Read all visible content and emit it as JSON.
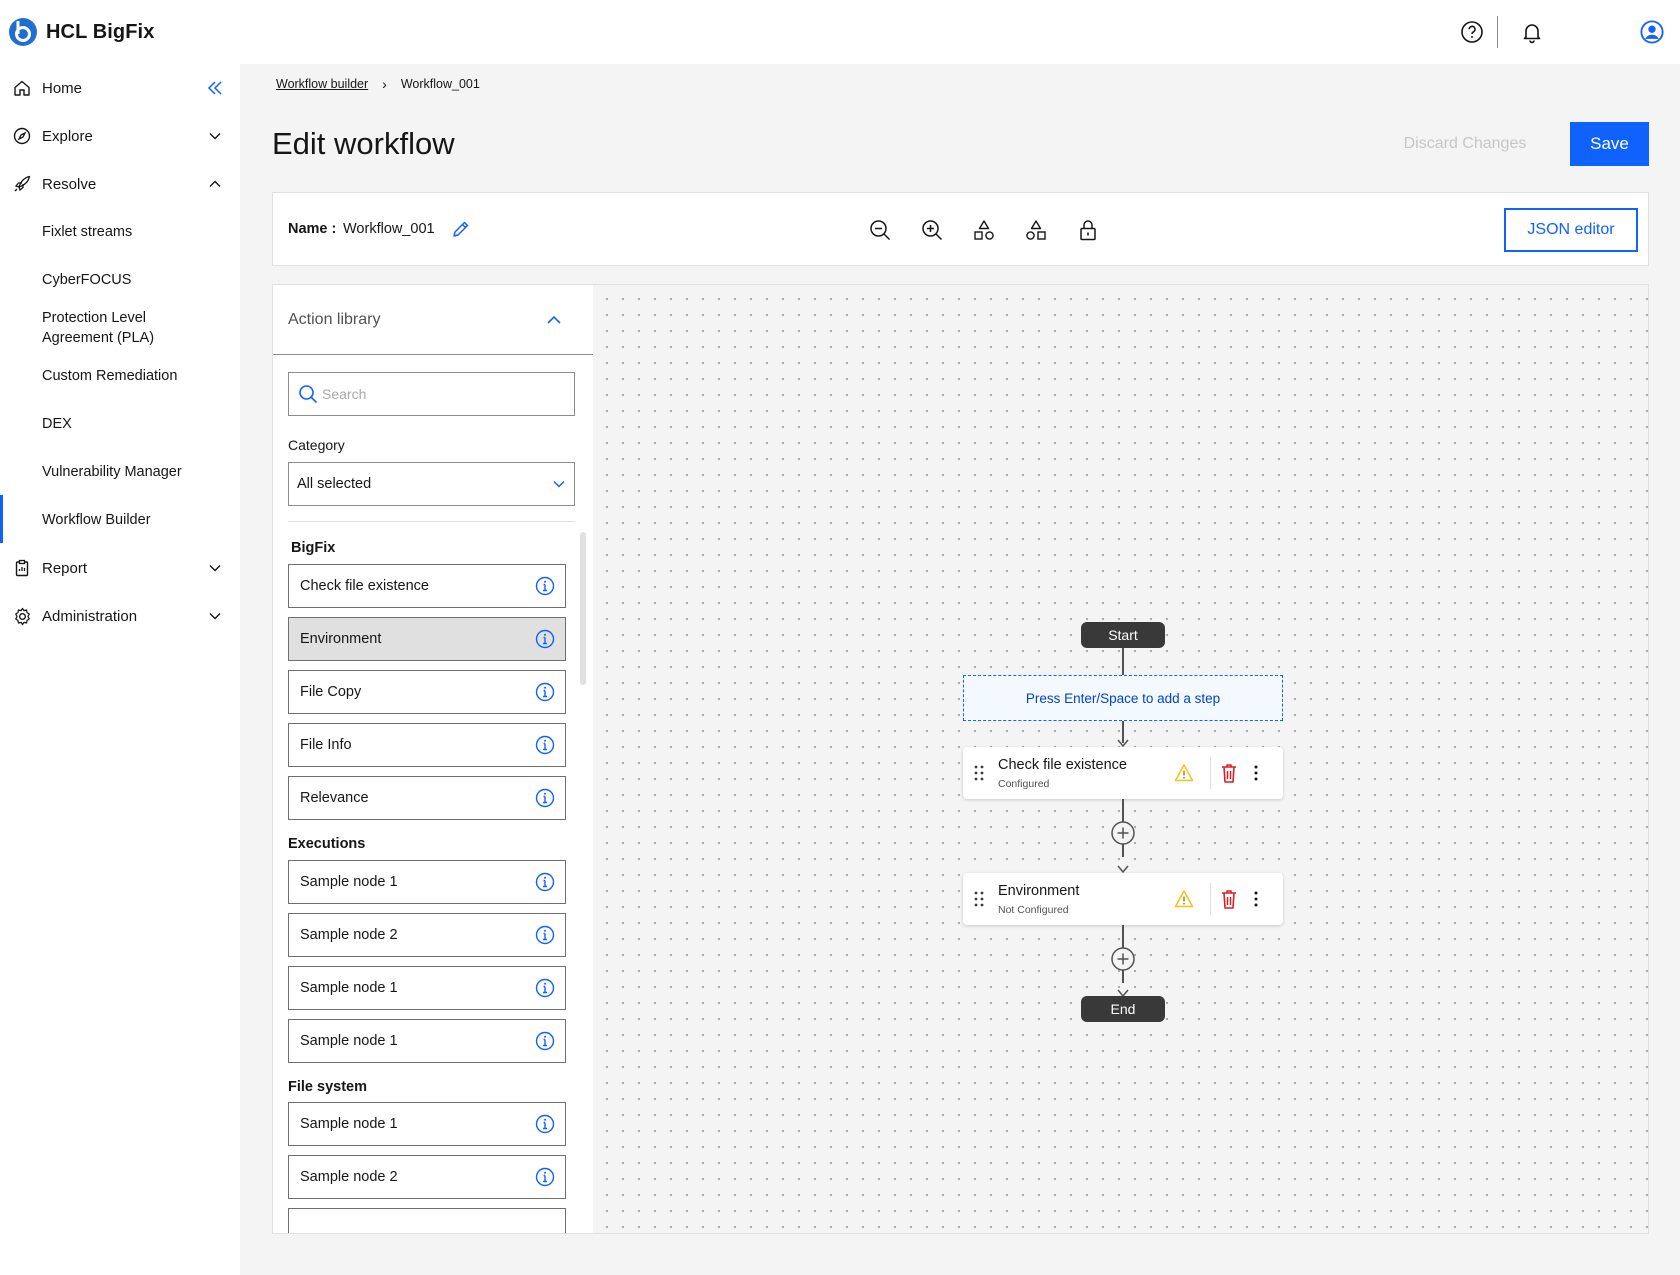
{
  "brand": {
    "name": "HCL BigFix"
  },
  "sidebar": {
    "items": [
      {
        "label": "Home",
        "icon": "home-icon"
      },
      {
        "label": "Explore",
        "icon": "compass-icon"
      },
      {
        "label": "Resolve",
        "icon": "rocket-icon"
      },
      {
        "label": "Report",
        "icon": "clipboard-icon"
      },
      {
        "label": "Administration",
        "icon": "gear-icon"
      }
    ],
    "resolve_children": [
      "Fixlet streams",
      "CyberFOCUS",
      "Protection Level Agreement (PLA)",
      "Custom Remediation",
      "DEX",
      "Vulnerability Manager",
      "Workflow Builder"
    ],
    "active_child": "Workflow Builder"
  },
  "breadcrumb": {
    "parent": "Workflow builder",
    "current": "Workflow_001"
  },
  "page": {
    "title": "Edit workflow",
    "discard_label": "Discard Changes",
    "save_label": "Save"
  },
  "toolbar": {
    "name_label": "Name :",
    "name_value": "Workflow_001",
    "json_editor_label": "JSON editor",
    "tools": [
      "zoom-out-icon",
      "zoom-in-icon",
      "shapes-icon",
      "shapes-alt-icon",
      "lock-icon"
    ]
  },
  "library": {
    "title": "Action library",
    "search_placeholder": "Search",
    "category_label": "Category",
    "category_value": "All selected",
    "groups": [
      {
        "name": "BigFix",
        "items": [
          "Check file existence",
          "Environment",
          "File Copy",
          "File Info",
          "Relevance"
        ],
        "selected": "Environment"
      },
      {
        "name": "Executions",
        "items": [
          "Sample node 1",
          "Sample node 2",
          "Sample node 1",
          "Sample node 1"
        ]
      },
      {
        "name": "File system",
        "items": [
          "Sample node 1",
          "Sample node 2"
        ]
      }
    ]
  },
  "canvas": {
    "start_label": "Start",
    "end_label": "End",
    "add_step_hint": "Press Enter/Space to add a step",
    "nodes": [
      {
        "title": "Check file existence",
        "status": "Configured"
      },
      {
        "title": "Environment",
        "status": "Not Configured"
      }
    ]
  },
  "colors": {
    "accent": "#0f62fe",
    "warning": "#f1c21b",
    "danger": "#da1e28",
    "pill": "#393939"
  }
}
